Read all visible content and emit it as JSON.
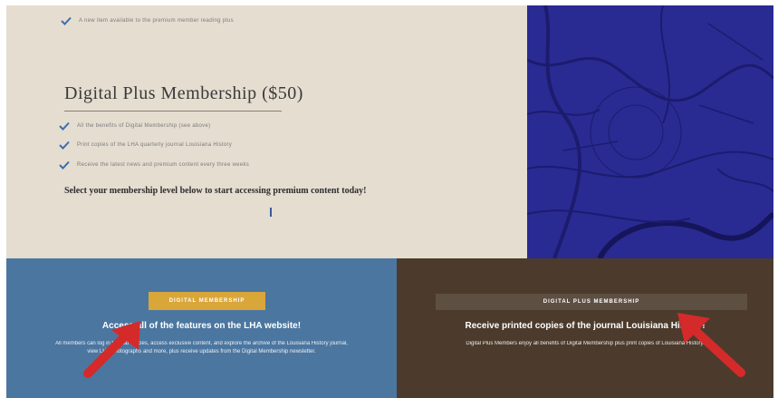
{
  "tier_top": {
    "benefit": "A new item available to the premium member reading plus"
  },
  "plus_section": {
    "title": "Digital Plus Membership ($50)",
    "benefits": [
      "All the benefits of Digital Membership (see above)",
      "Print copies of the LHA quarterly journal Louisiana History",
      "Receive the latest news and premium content every three weeks"
    ],
    "cta": "Select your membership level below to start accessing premium content today!"
  },
  "digital_panel": {
    "button_label": "DIGITAL MEMBERSHIP",
    "heading": "Access all of the features on the LHA website!",
    "description": "All members can log in to read articles, access exclusive content, and explore the archive of the Louisiana History journal, view LHA photographs and more, plus receive updates from the Digital Membership newsletter."
  },
  "plus_panel": {
    "button_label": "DIGITAL PLUS MEMBERSHIP",
    "heading": "Receive printed copies of the journal Louisiana History!",
    "description": "Digital Plus Members enjoy all benefits of Digital Membership plus print copies of Louisiana History."
  },
  "colors": {
    "map_blue": "#2a2a93",
    "panel_blue": "#4b76a0",
    "panel_brown": "#4c3b2c",
    "button_gold": "#d9a63a",
    "check_blue": "#3a6fb0",
    "arrow_red": "#d42a2a"
  }
}
